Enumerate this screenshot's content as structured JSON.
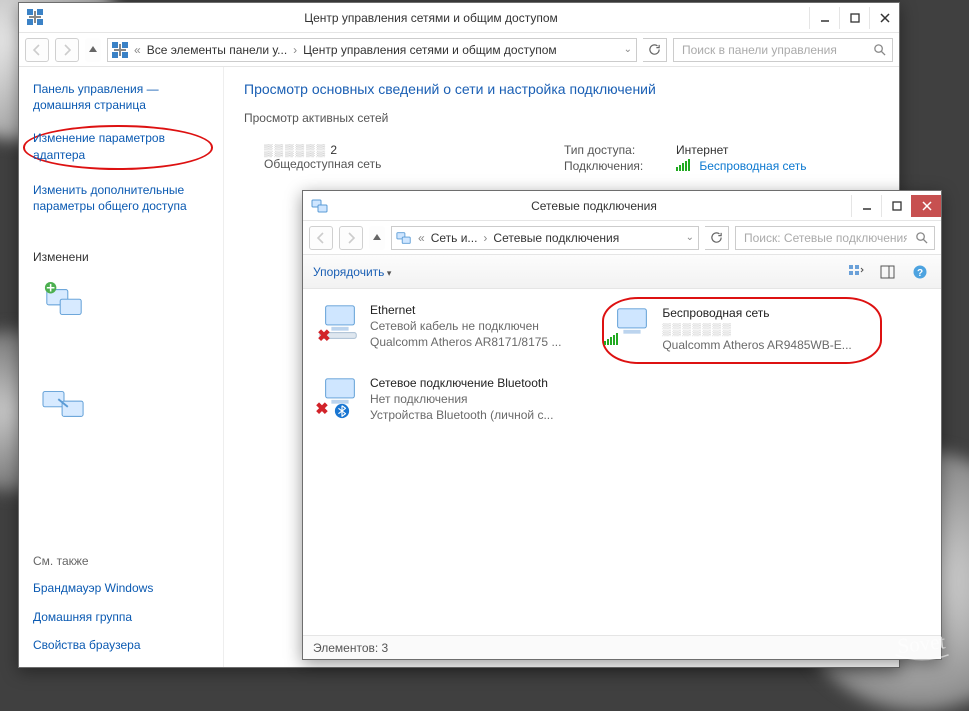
{
  "win1": {
    "title": "Центр управления сетями и общим доступом",
    "breadcrumb": {
      "root_icon": "net-center-icon",
      "crumb1": "Все элементы панели у...",
      "crumb2": "Центр управления сетями и общим доступом"
    },
    "search_placeholder": "Поиск в панели управления",
    "sidebar": {
      "home": "Панель управления — домашняя страница",
      "change_adapter": "Изменение параметров адаптера",
      "change_sharing": "Изменить дополнительные параметры общего доступа",
      "partial": "Изменени",
      "see_also": "См. также",
      "firewall": "Брандмауэр Windows",
      "homegroup": "Домашняя группа",
      "browser": "Свойства браузера"
    },
    "content": {
      "heading": "Просмотр основных сведений о сети и настройка подключений",
      "active_nets": "Просмотр активных сетей",
      "net_number": "2",
      "net_type": "Общедоступная сеть",
      "type_label": "Тип доступа:",
      "type_value": "Интернет",
      "conn_label": "Подключения:",
      "conn_value": "Беспроводная сеть"
    }
  },
  "win2": {
    "title": "Сетевые подключения",
    "breadcrumb": {
      "crumb1": "Сеть и...",
      "crumb2": "Сетевые подключения"
    },
    "search_placeholder": "Поиск: Сетевые подключения",
    "toolbar": {
      "organize": "Упорядочить"
    },
    "adapters": [
      {
        "name": "Ethernet",
        "line2": "Сетевой кабель не подключен",
        "line3": "Qualcomm Atheros AR8171/8175 ...",
        "status": "disconnected"
      },
      {
        "name": "Беспроводная сеть",
        "line2": " ",
        "line3": "Qualcomm Atheros AR9485WB-E...",
        "status": "wifi"
      },
      {
        "name": "Сетевое подключение Bluetooth",
        "line2": "Нет подключения",
        "line3": "Устройства Bluetooth (личной с...",
        "status": "bluetooth-off"
      }
    ],
    "status": "Элементов: 3"
  }
}
